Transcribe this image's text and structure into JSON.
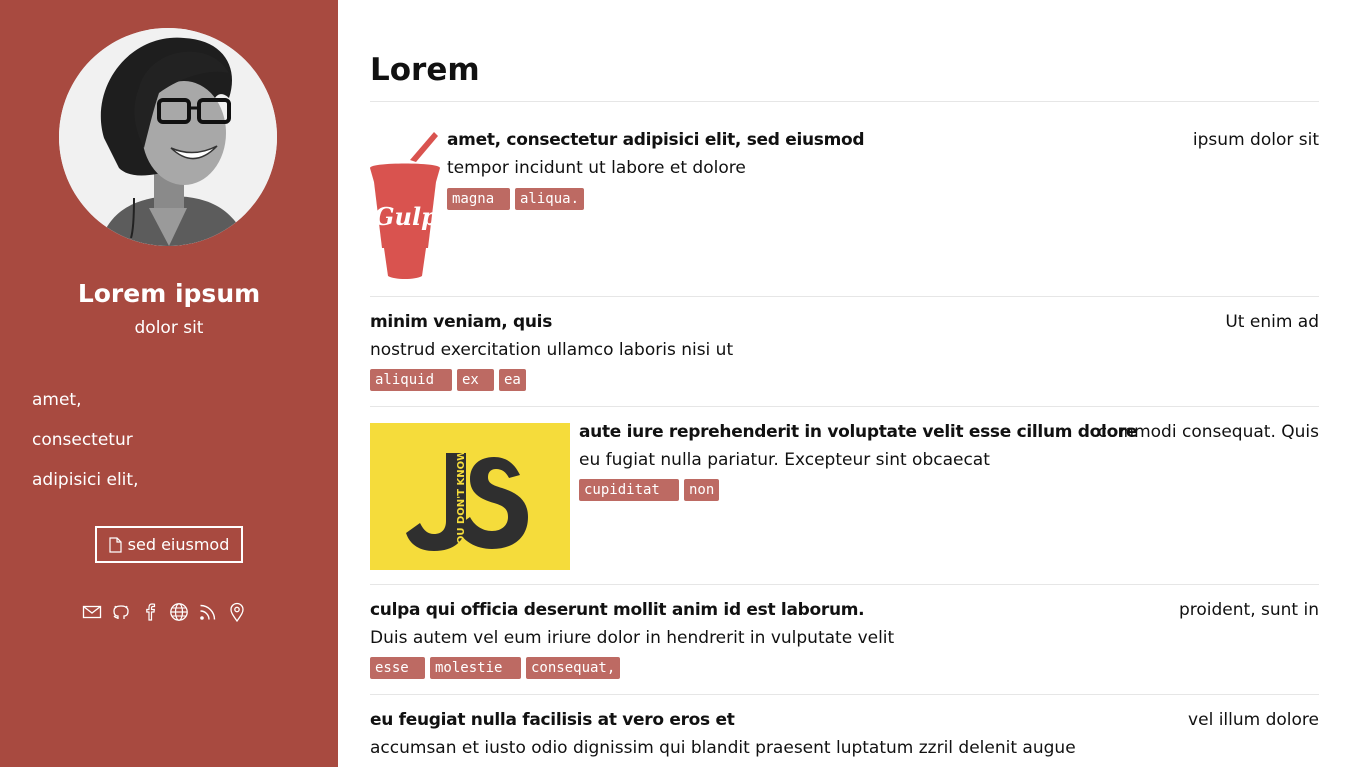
{
  "sidebar": {
    "name": "Lorem ipsum",
    "subtitle": "dolor sit",
    "links": [
      "amet,",
      "consectetur",
      "adipisici elit,"
    ],
    "resume_button": "sed eiusmod",
    "social_icons": [
      "mail-icon",
      "github-icon",
      "facebook-icon",
      "globe-icon",
      "rss-icon",
      "location-pin-icon"
    ]
  },
  "main": {
    "title": "Lorem",
    "entries": [
      {
        "title": "amet, consectetur adipisici elit, sed eiusmod",
        "date": "ipsum dolor sit",
        "description": "tempor incidunt ut labore et dolore",
        "tags": [
          "magna",
          "aliqua."
        ],
        "thumbnail": "gulp-cup-logo"
      },
      {
        "title": "minim veniam, quis",
        "date": "Ut enim ad",
        "description": "nostrud exercitation ullamco laboris nisi ut",
        "tags": [
          "aliquid",
          "ex",
          "ea"
        ]
      },
      {
        "title": "aute iure reprehenderit in voluptate velit esse cillum dolore",
        "date": "commodi consequat. Quis",
        "description": "eu fugiat nulla pariatur. Excepteur sint obcaecat",
        "tags": [
          "cupiditat",
          "non"
        ],
        "thumbnail": "you-dont-know-js-cover",
        "thumbnail_text": "YOU DON'T KNOW"
      },
      {
        "title": "culpa qui officia deserunt mollit anim id est laborum.",
        "date": "proident, sunt in",
        "description": "Duis autem vel eum iriure dolor in hendrerit in vulputate velit",
        "tags": [
          "esse",
          "molestie",
          "consequat,"
        ]
      },
      {
        "title": "eu feugiat nulla facilisis at vero eros et",
        "date": "vel illum dolore",
        "description": "accumsan et iusto odio dignissim qui blandit praesent luptatum zzril delenit augue",
        "tags": []
      }
    ]
  },
  "colors": {
    "sidebar_bg": "#a84a40",
    "tag_bg": "#bd6a63",
    "gulp_red": "#d9534f",
    "js_yellow": "#f5dc3b"
  }
}
